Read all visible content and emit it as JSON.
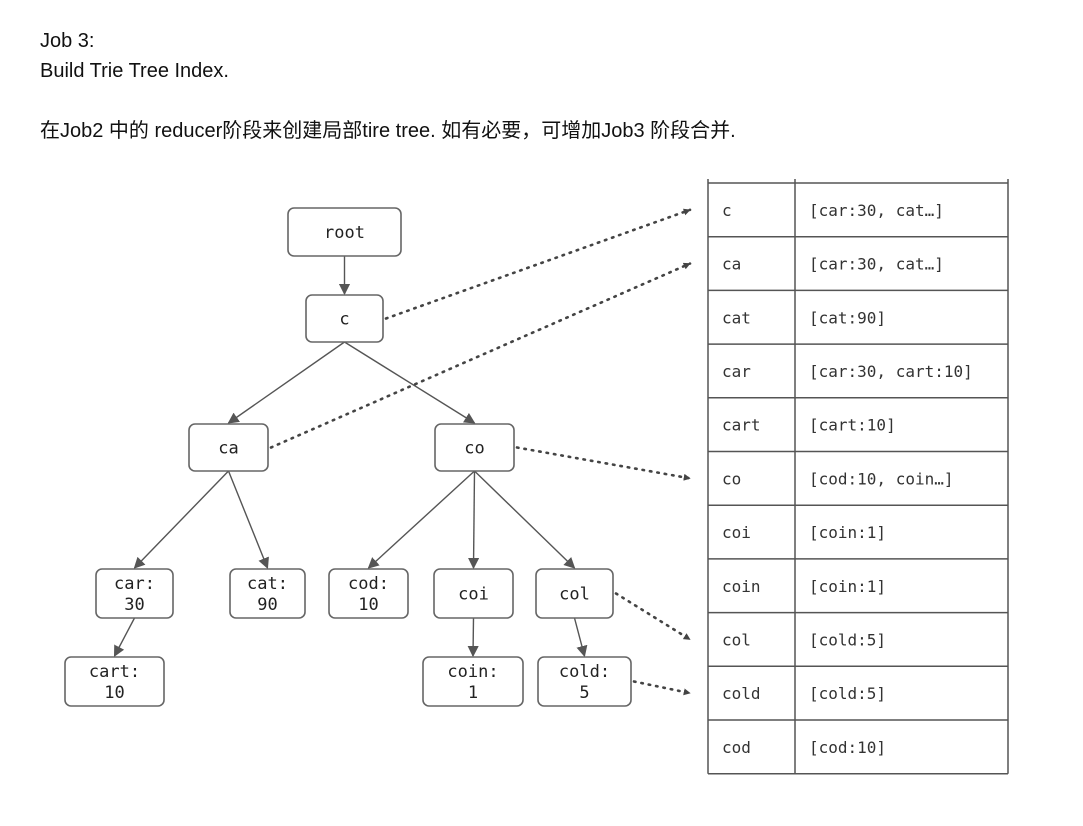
{
  "heading": {
    "job_line": "Job 3:",
    "subtitle": "Build Trie Tree Index.",
    "description": "在Job2 中的 reducer阶段来创建局部tire tree. 如有必要，可增加Job3 阶段合并."
  },
  "tree": {
    "nodes": [
      {
        "id": "root",
        "lines": [
          "root"
        ]
      },
      {
        "id": "c",
        "lines": [
          "c"
        ]
      },
      {
        "id": "ca",
        "lines": [
          "ca"
        ]
      },
      {
        "id": "co",
        "lines": [
          "co"
        ]
      },
      {
        "id": "car",
        "lines": [
          "car:",
          "30"
        ]
      },
      {
        "id": "cat",
        "lines": [
          "cat:",
          "90"
        ]
      },
      {
        "id": "cod",
        "lines": [
          "cod:",
          "10"
        ]
      },
      {
        "id": "coi",
        "lines": [
          "coi"
        ]
      },
      {
        "id": "col",
        "lines": [
          "col"
        ]
      },
      {
        "id": "cart",
        "lines": [
          "cart:",
          "10"
        ]
      },
      {
        "id": "coin",
        "lines": [
          "coin:",
          "1"
        ]
      },
      {
        "id": "cold",
        "lines": [
          "cold:",
          "5"
        ]
      }
    ],
    "edges": [
      [
        "root",
        "c"
      ],
      [
        "c",
        "ca"
      ],
      [
        "c",
        "co"
      ],
      [
        "ca",
        "car"
      ],
      [
        "ca",
        "cat"
      ],
      [
        "co",
        "cod"
      ],
      [
        "co",
        "coi"
      ],
      [
        "co",
        "col"
      ],
      [
        "car",
        "cart"
      ],
      [
        "coi",
        "coin"
      ],
      [
        "col",
        "cold"
      ]
    ],
    "pointers": [
      {
        "from": "c",
        "to_row": "c"
      },
      {
        "from": "ca",
        "to_row": "ca"
      },
      {
        "from": "co",
        "to_row": "co"
      },
      {
        "from": "col",
        "to_row": "col"
      },
      {
        "from": "cold",
        "to_row": "cold"
      }
    ]
  },
  "index_table": {
    "rows": [
      {
        "key": "c",
        "value": "[car:30, cat…]"
      },
      {
        "key": "ca",
        "value": "[car:30, cat…]"
      },
      {
        "key": "cat",
        "value": "[cat:90]"
      },
      {
        "key": "car",
        "value": "[car:30, cart:10]"
      },
      {
        "key": "cart",
        "value": "[cart:10]"
      },
      {
        "key": "co",
        "value": "[cod:10, coin…]"
      },
      {
        "key": "coi",
        "value": "[coin:1]"
      },
      {
        "key": "coin",
        "value": "[coin:1]"
      },
      {
        "key": "col",
        "value": "[cold:5]"
      },
      {
        "key": "cold",
        "value": "[cold:5]"
      },
      {
        "key": "cod",
        "value": "[cod:10]"
      }
    ]
  }
}
